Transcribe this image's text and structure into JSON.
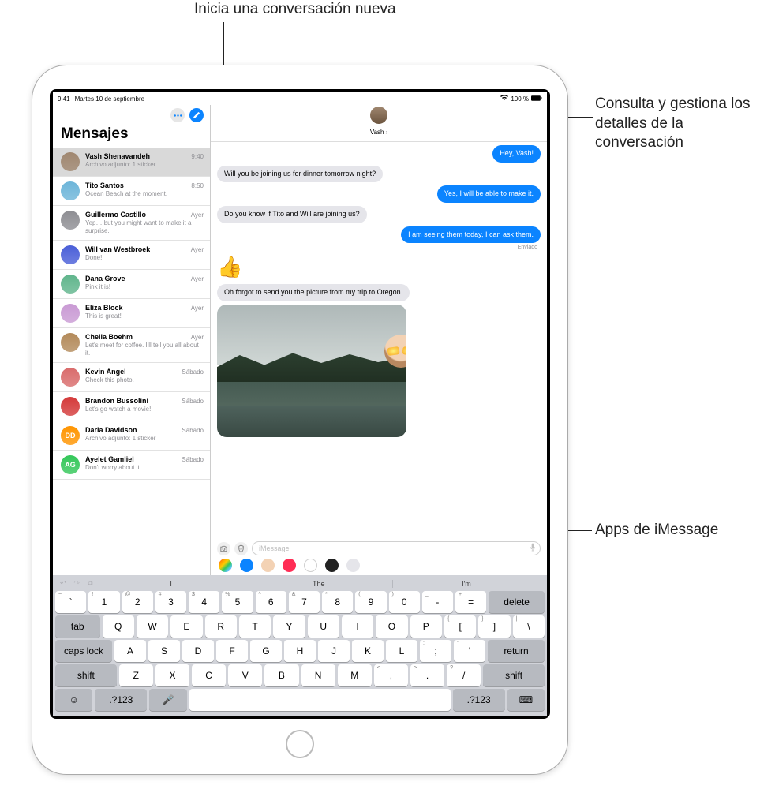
{
  "callouts": {
    "compose": "Inicia una conversación nueva",
    "details": "Consulta y gestiona los detalles de la conversación",
    "apps": "Apps de iMessage"
  },
  "status": {
    "time": "9:41",
    "date": "Martes 10 de septiembre",
    "battery": "100 %"
  },
  "sidebar": {
    "title": "Mensajes",
    "items": [
      {
        "name": "Vash Shenavandeh",
        "time": "9:40",
        "preview": "Archivo adjunto: 1 sticker",
        "color": "#a08770"
      },
      {
        "name": "Tito Santos",
        "time": "8:50",
        "preview": "Ocean Beach at the moment.",
        "color": "#6db5d9"
      },
      {
        "name": "Guillermo Castillo",
        "time": "Ayer",
        "preview": "Yep… but you might want to make it a surprise.",
        "color": "#8e8e93"
      },
      {
        "name": "Will van Westbroek",
        "time": "Ayer",
        "preview": "Done!",
        "color": "#4a5fd8"
      },
      {
        "name": "Dana Grove",
        "time": "Ayer",
        "preview": "Pink it is!",
        "color": "#60b58c"
      },
      {
        "name": "Eliza Block",
        "time": "Ayer",
        "preview": "This is great!",
        "color": "#c99ad4"
      },
      {
        "name": "Chella Boehm",
        "time": "Ayer",
        "preview": "Let's meet for coffee. I'll tell you all about it.",
        "color": "#b38a5a"
      },
      {
        "name": "Kevin Angel",
        "time": "Sábado",
        "preview": "Check this photo.",
        "color": "#d96b6b"
      },
      {
        "name": "Brandon Bussolini",
        "time": "Sábado",
        "preview": "Let's go watch a movie!",
        "color": "#d43a3a"
      },
      {
        "name": "Darla Davidson",
        "time": "Sábado",
        "preview": "Archivo adjunto: 1 sticker",
        "initials": "DD",
        "color": "#ff9500"
      },
      {
        "name": "Ayelet Gamliel",
        "time": "Sábado",
        "preview": "Don't worry about it.",
        "initials": "AG",
        "color": "#34c759"
      }
    ]
  },
  "conversation": {
    "contactName": "Vash",
    "messages": [
      {
        "dir": "out",
        "text": "Hey, Vash!"
      },
      {
        "dir": "in",
        "text": "Will you be joining us for dinner tomorrow night?"
      },
      {
        "dir": "out",
        "text": "Yes, I will be able to make it."
      },
      {
        "dir": "in",
        "text": "Do you know if Tito and Will are joining us?"
      },
      {
        "dir": "out",
        "text": "I am seeing them today, I can ask them."
      },
      {
        "dir": "status",
        "text": "Enviado"
      },
      {
        "dir": "emoji",
        "text": "👍"
      },
      {
        "dir": "in",
        "text": "Oh forgot to send you the picture from my trip to Oregon."
      },
      {
        "dir": "photo"
      }
    ],
    "inputPlaceholder": "iMessage"
  },
  "appDrawer": {
    "apps": [
      {
        "name": "photos-app",
        "color": "linear-gradient(135deg,#ff2d55,#ff9500,#ffcc00,#34c759,#5ac8fa,#af52de)"
      },
      {
        "name": "appstore-app",
        "color": "#0b84ff"
      },
      {
        "name": "memoji-app",
        "color": "#f3d2b4"
      },
      {
        "name": "images-app",
        "color": "#ff2d55"
      },
      {
        "name": "music-app",
        "color": "#fff"
      },
      {
        "name": "digital-touch",
        "color": "#222"
      },
      {
        "name": "more-apps",
        "color": "#e5e5ea"
      }
    ]
  },
  "keyboard": {
    "suggestions": [
      "I",
      "The",
      "I'm"
    ],
    "row1": [
      {
        "main": "`",
        "sup": "~"
      },
      {
        "main": "1",
        "sup": "!"
      },
      {
        "main": "2",
        "sup": "@"
      },
      {
        "main": "3",
        "sup": "#"
      },
      {
        "main": "4",
        "sup": "$"
      },
      {
        "main": "5",
        "sup": "%"
      },
      {
        "main": "6",
        "sup": "^"
      },
      {
        "main": "7",
        "sup": "&"
      },
      {
        "main": "8",
        "sup": "*"
      },
      {
        "main": "9",
        "sup": "("
      },
      {
        "main": "0",
        "sup": ")"
      },
      {
        "main": "-",
        "sup": "_"
      },
      {
        "main": "=",
        "sup": "+"
      }
    ],
    "row2": [
      "Q",
      "W",
      "E",
      "R",
      "T",
      "Y",
      "U",
      "I",
      "O",
      "P"
    ],
    "row2brackets": [
      {
        "main": "[",
        "sup": "{"
      },
      {
        "main": "]",
        "sup": "}"
      },
      {
        "main": "\\",
        "sup": "|"
      }
    ],
    "row3": [
      "A",
      "S",
      "D",
      "F",
      "G",
      "H",
      "J",
      "K",
      "L"
    ],
    "row3punct": [
      {
        "main": ";",
        "sup": ":"
      },
      {
        "main": "'",
        "sup": "\""
      }
    ],
    "row4": [
      "Z",
      "X",
      "C",
      "V",
      "B",
      "N",
      "M"
    ],
    "row4punct": [
      {
        "main": ",",
        "sup": "<"
      },
      {
        "main": ".",
        "sup": ">"
      },
      {
        "main": "/",
        "sup": "? "
      }
    ],
    "labels": {
      "delete": "delete",
      "tab": "tab",
      "capslock": "caps lock",
      "return": "return",
      "shift": "shift",
      "numpad": ".?123"
    }
  }
}
